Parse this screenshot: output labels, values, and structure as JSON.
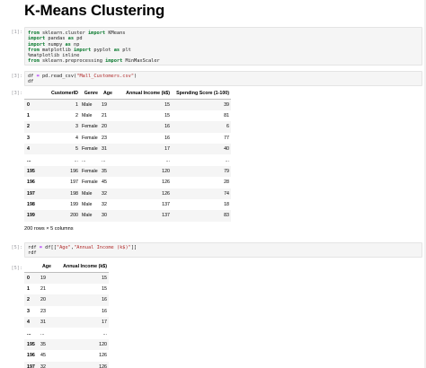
{
  "page_title": "K-Means Clustering",
  "cells": [
    {
      "prompt": "[1]:",
      "code_lines": [
        [
          [
            "kw",
            "from"
          ],
          [
            "t",
            " sklearn.cluster "
          ],
          [
            "kw",
            "import"
          ],
          [
            "t",
            " KMeans"
          ]
        ],
        [
          [
            "kw",
            "import"
          ],
          [
            "t",
            " pandas "
          ],
          [
            "kw",
            "as"
          ],
          [
            "t",
            " pd"
          ]
        ],
        [
          [
            "kw",
            "import"
          ],
          [
            "t",
            " numpy "
          ],
          [
            "kw",
            "as"
          ],
          [
            "t",
            " np"
          ]
        ],
        [
          [
            "kw",
            "from"
          ],
          [
            "t",
            " matplotlib "
          ],
          [
            "kw",
            "import"
          ],
          [
            "t",
            " pyplot "
          ],
          [
            "kw",
            "as"
          ],
          [
            "t",
            " plt"
          ]
        ],
        [
          [
            "t",
            "%matplotlib inline"
          ]
        ],
        [
          [
            "kw",
            "from"
          ],
          [
            "t",
            " sklearn.preprocessing "
          ],
          [
            "kw",
            "import"
          ],
          [
            "t",
            " MinMaxScaler"
          ]
        ]
      ]
    },
    {
      "prompt": "[3]:",
      "code_lines": [
        [
          [
            "t",
            "df "
          ],
          [
            "op",
            "="
          ],
          [
            "t",
            " pd.read_csv("
          ],
          [
            "str",
            "\"Mall_Customers.csv\""
          ],
          [
            "t",
            ")"
          ]
        ],
        [
          [
            "t",
            "df"
          ]
        ]
      ]
    },
    {
      "prompt": "[3]:",
      "output": true
    },
    {
      "prompt": "[5]:",
      "code_lines": [
        [
          [
            "t",
            "rdf "
          ],
          [
            "op",
            "="
          ],
          [
            "t",
            " df[["
          ],
          [
            "str",
            "\"Age\""
          ],
          [
            "t",
            ","
          ],
          [
            "str",
            "\"Annual Income (k$)\""
          ],
          [
            "t",
            "]]"
          ]
        ],
        [
          [
            "t",
            "rdf"
          ]
        ]
      ]
    },
    {
      "prompt": "[5]:",
      "output": true
    }
  ],
  "df_table": {
    "columns": [
      "",
      "CustomerID",
      "Genre",
      "Age",
      "Annual Income (k$)",
      "Spending Score (1-100)"
    ],
    "rows": [
      [
        "0",
        "1",
        "Male",
        "19",
        "15",
        "39"
      ],
      [
        "1",
        "2",
        "Male",
        "21",
        "15",
        "81"
      ],
      [
        "2",
        "3",
        "Female",
        "20",
        "16",
        "6"
      ],
      [
        "3",
        "4",
        "Female",
        "23",
        "16",
        "77"
      ],
      [
        "4",
        "5",
        "Female",
        "31",
        "17",
        "40"
      ],
      [
        "...",
        "...",
        "...",
        "...",
        "...",
        "..."
      ],
      [
        "195",
        "196",
        "Female",
        "35",
        "120",
        "79"
      ],
      [
        "196",
        "197",
        "Female",
        "45",
        "126",
        "28"
      ],
      [
        "197",
        "198",
        "Male",
        "32",
        "126",
        "74"
      ],
      [
        "198",
        "199",
        "Male",
        "32",
        "137",
        "18"
      ],
      [
        "199",
        "200",
        "Male",
        "30",
        "137",
        "83"
      ]
    ],
    "shape_text": "200 rows × 5 columns"
  },
  "rdf_table": {
    "columns": [
      "",
      "Age",
      "Annual Income (k$)"
    ],
    "rows": [
      [
        "0",
        "19",
        "15"
      ],
      [
        "1",
        "21",
        "15"
      ],
      [
        "2",
        "20",
        "16"
      ],
      [
        "3",
        "23",
        "16"
      ],
      [
        "4",
        "31",
        "17"
      ],
      [
        "...",
        "...",
        "..."
      ],
      [
        "195",
        "35",
        "120"
      ],
      [
        "196",
        "45",
        "126"
      ],
      [
        "197",
        "32",
        "126"
      ]
    ]
  },
  "colors": {
    "keyword": "#0b7a2f",
    "string": "#b02a2a",
    "operator": "#aa22ff",
    "prompt": "#9a9aa0",
    "input_bg": "#f5f5f5",
    "row_stripe": "#f5f5f5"
  }
}
